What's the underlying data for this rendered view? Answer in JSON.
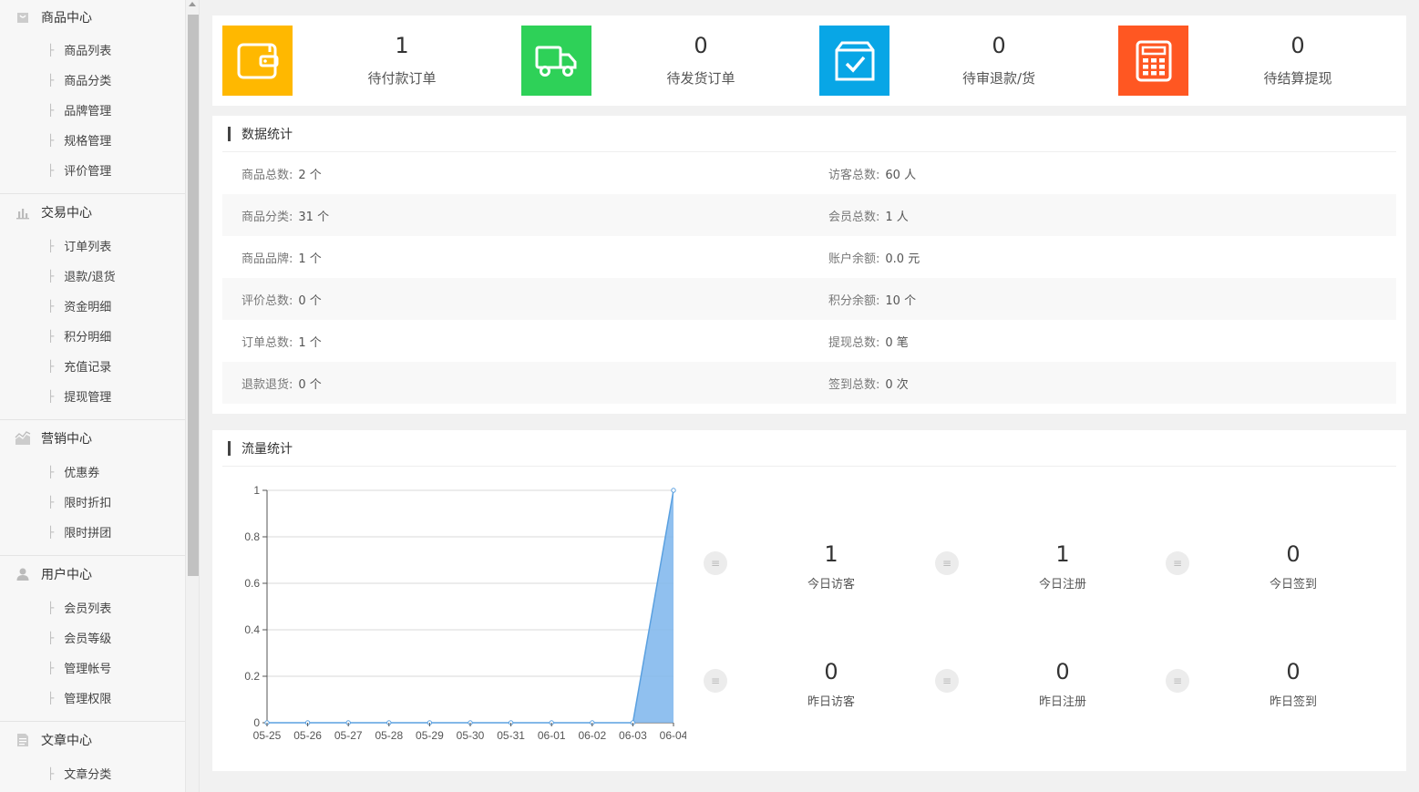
{
  "sidebar": {
    "groups": [
      {
        "title": "商品中心",
        "icon": "bag-icon",
        "items": [
          "商品列表",
          "商品分类",
          "品牌管理",
          "规格管理",
          "评价管理"
        ]
      },
      {
        "title": "交易中心",
        "icon": "bar-chart-icon",
        "items": [
          "订单列表",
          "退款/退货",
          "资金明细",
          "积分明细",
          "充值记录",
          "提现管理"
        ]
      },
      {
        "title": "营销中心",
        "icon": "trend-chart-icon",
        "items": [
          "优惠券",
          "限时折扣",
          "限时拼团"
        ]
      },
      {
        "title": "用户中心",
        "icon": "user-icon",
        "items": [
          "会员列表",
          "会员等级",
          "管理帐号",
          "管理权限"
        ]
      },
      {
        "title": "文章中心",
        "icon": "document-icon",
        "items": [
          "文章分类"
        ]
      }
    ]
  },
  "cards": [
    {
      "value": "1",
      "label": "待付款订单",
      "icon": "wallet-icon",
      "color": "#FFB800"
    },
    {
      "value": "0",
      "label": "待发货订单",
      "icon": "truck-icon",
      "color": "#2ED158"
    },
    {
      "value": "0",
      "label": "待审退款/货",
      "icon": "check-box-icon",
      "color": "#08A6E6"
    },
    {
      "value": "0",
      "label": "待结算提现",
      "icon": "calculator-icon",
      "color": "#FF5722"
    }
  ],
  "stats": {
    "title": "数据统计",
    "rows": [
      {
        "left_key": "商品总数:",
        "left_val": "2 个",
        "right_key": "访客总数:",
        "right_val": "60 人"
      },
      {
        "left_key": "商品分类:",
        "left_val": "31 个",
        "right_key": "会员总数:",
        "right_val": "1 人"
      },
      {
        "left_key": "商品品牌:",
        "left_val": "1 个",
        "right_key": "账户余额:",
        "right_val": "0.0 元"
      },
      {
        "left_key": "评价总数:",
        "left_val": "0 个",
        "right_key": "积分余额:",
        "right_val": "10 个"
      },
      {
        "left_key": "订单总数:",
        "left_val": "1 个",
        "right_key": "提现总数:",
        "right_val": "0 笔"
      },
      {
        "left_key": "退款退货:",
        "left_val": "0 个",
        "right_key": "签到总数:",
        "right_val": "0 次"
      }
    ]
  },
  "traffic": {
    "title": "流量统计",
    "items": [
      {
        "value": "1",
        "label": "今日访客"
      },
      {
        "value": "1",
        "label": "今日注册"
      },
      {
        "value": "0",
        "label": "今日签到"
      },
      {
        "value": "0",
        "label": "昨日访客"
      },
      {
        "value": "0",
        "label": "昨日注册"
      },
      {
        "value": "0",
        "label": "昨日签到"
      }
    ],
    "dot_glyph": "≡"
  },
  "chart_data": {
    "type": "area",
    "x": [
      "05-25",
      "05-26",
      "05-27",
      "05-28",
      "05-29",
      "05-30",
      "05-31",
      "06-01",
      "06-02",
      "06-03",
      "06-04"
    ],
    "series": [
      {
        "values": [
          0,
          0,
          0,
          0,
          0,
          0,
          0,
          0,
          0,
          0,
          1
        ]
      }
    ],
    "ylim": [
      0,
      1
    ],
    "yticks": [
      "0",
      "0.2",
      "0.4",
      "0.6",
      "0.8",
      "1"
    ],
    "grid": true,
    "color": "#7CB5EC"
  }
}
